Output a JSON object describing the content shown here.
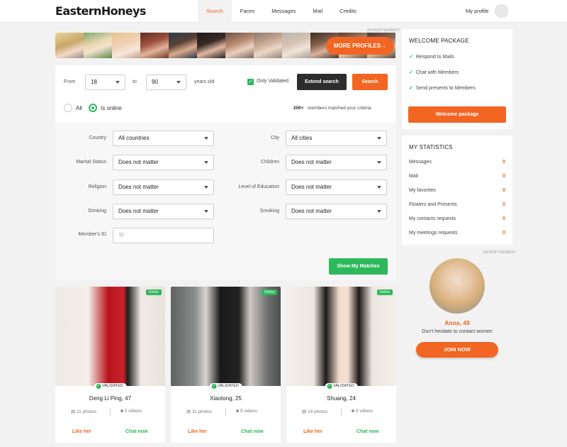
{
  "app": {
    "logo": "EasternHoneys"
  },
  "nav": {
    "items": [
      {
        "label": "Search",
        "active": true
      },
      {
        "label": "Faces"
      },
      {
        "label": "Messages"
      },
      {
        "label": "Mail"
      },
      {
        "label": "Credits"
      }
    ],
    "profile_label": "My profile"
  },
  "ad_label": "ADVERTISEMENT",
  "strip": {
    "more_label": "MORE PROFILES→"
  },
  "search": {
    "from_label": "From",
    "age_from": "18",
    "to_label": "to",
    "age_to": "90",
    "years_label": "years old",
    "only_validated": "Only Validated",
    "extend_label": "Extend search",
    "search_label": "Search",
    "radio_all": "All",
    "radio_online": "Is online",
    "match_count": "200+",
    "match_text": "members matched your criteria",
    "filters": {
      "country_label": "Country",
      "country_value": "All countries",
      "city_label": "City",
      "city_value": "All cities",
      "marital_label": "Marital Status",
      "marital_value": "Does not matter",
      "children_label": "Children",
      "children_value": "Does not matter",
      "religion_label": "Religion",
      "religion_value": "Does not matter",
      "education_label": "Level of Education",
      "education_value": "Does not matter",
      "drinking_label": "Drinking",
      "drinking_value": "Does not matter",
      "smoking_label": "Smoking",
      "smoking_value": "Does not matter",
      "member_id_label": "Member's ID",
      "member_id_placeholder": "ID"
    },
    "show_matches": "Show My Matches"
  },
  "cards": [
    {
      "name": "Deng Li Ping, 47",
      "photos": "11 photos",
      "videos": "0 videos",
      "online": "Online",
      "validated": "VALIDATED",
      "like": "Like her",
      "chat": "Chat now"
    },
    {
      "name": "Xiaotong, 25",
      "photos": "11 photos",
      "videos": "0 videos",
      "online": "Online",
      "validated": "VALIDATED",
      "like": "Like her",
      "chat": "Chat now"
    },
    {
      "name": "Shuang, 24",
      "photos": "14 photos",
      "videos": "0 videos",
      "online": "Online",
      "validated": "VALIDATED",
      "like": "Like her",
      "chat": "Chat now"
    }
  ],
  "welcome": {
    "title": "WELCOME PACKAGE",
    "items": [
      "Respond to Mails",
      "Chat with Members",
      "Send presents to Members"
    ],
    "button": "Welcome package"
  },
  "stats": {
    "title": "MY STATISTICS",
    "rows": [
      {
        "label": "Messages",
        "value": "0"
      },
      {
        "label": "Mail",
        "value": "0"
      },
      {
        "label": "My favorites",
        "value": "0"
      },
      {
        "label": "Flowers and Presents",
        "value": "0"
      },
      {
        "label": "My contacts requests",
        "value": "0"
      },
      {
        "label": "My meetings requests",
        "value": "0"
      }
    ]
  },
  "promo": {
    "name": "Anna, 48",
    "subtitle": "Don't hesitate to contact women",
    "button": "JOIN NOW"
  },
  "colors": {
    "accent": "#f26522",
    "green": "#2eb85c",
    "dark_button": "#2d2d2d"
  }
}
